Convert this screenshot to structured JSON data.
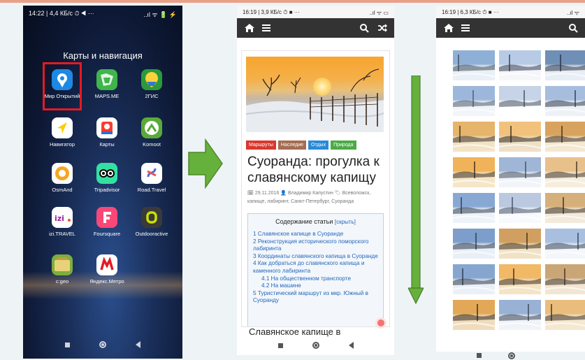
{
  "phone1": {
    "status": {
      "left": "14:22 | 4,4 КБ/с ⏱ ◀ ···",
      "right": "..ıl ᯤ 🔋 ⚡"
    },
    "folder_title": "Карты и навигация",
    "apps": [
      {
        "label": "Мир Открытий",
        "color": "#1e88e5"
      },
      {
        "label": "MAPS.ME",
        "color": "#3fb54b"
      },
      {
        "label": "2ГИС",
        "color": "#2a9a3a"
      },
      {
        "label": "Навигатор",
        "color": "#ffffff"
      },
      {
        "label": "Карты",
        "color": "#ffffff"
      },
      {
        "label": "Komoot",
        "color": "#5aaa3a"
      },
      {
        "label": "OsmAnd",
        "color": "#ffffff"
      },
      {
        "label": "Tripadvisor",
        "color": "#34e0a1"
      },
      {
        "label": "Road.Travel",
        "color": "#ffffff"
      },
      {
        "label": "izi.TRAVEL",
        "color": "#ffffff"
      },
      {
        "label": "Foursquare",
        "color": "#f94877"
      },
      {
        "label": "Outdooractive",
        "color": "#3a3a3a"
      },
      {
        "label": "c:geo",
        "color": "#7cae3c"
      },
      {
        "label": "Яндекс.Метро",
        "color": "#ffffff"
      }
    ]
  },
  "phone2": {
    "status": {
      "left": "16:19 | 3,9 КБ/с ⏱ ■ ···",
      "right": "..ıl ᯤ ▭"
    },
    "tags": [
      {
        "label": "Маршруты",
        "color": "#d9372f"
      },
      {
        "label": "Наследие",
        "color": "#a56d52"
      },
      {
        "label": "Отдых",
        "color": "#2b8ad6"
      },
      {
        "label": "Природа",
        "color": "#4caa46"
      }
    ],
    "title": "Суоранда: прогулка к славянскому капищу",
    "meta": "🗓 29.11.2016  👤 Владимир Капустин  🏷 Всеволожск, капище, лабиринт, Санкт-Петербург, Суоранда",
    "toc_title": "Содержание статьи",
    "toc_hide": "[скрыть]",
    "toc": [
      {
        "text": "1 Славянское капище в Суоранде",
        "sub": false
      },
      {
        "text": "2 Реконструкция исторического поморского лабиринта",
        "sub": false
      },
      {
        "text": "3 Координаты славянского капища в Суоранде",
        "sub": false
      },
      {
        "text": "4 Как добраться до славянского капища и каменного лабиринта",
        "sub": false
      },
      {
        "text": "4.1 На общественном транспорте",
        "sub": true
      },
      {
        "text": "4.2 На машине",
        "sub": true
      },
      {
        "text": "5 Туристический маршрут из мкр. Южный в Суоранду",
        "sub": false
      }
    ],
    "next_heading": "Славянское капище в"
  },
  "phone3": {
    "status": {
      "left": "16:19 | 6,3 КБ/с ⏱ ■ ···",
      "right": "..ıl ᯤ"
    }
  },
  "colors": {
    "arrow_green": "#66b13b",
    "appbar": "#333333",
    "selection": "#e31b23"
  }
}
